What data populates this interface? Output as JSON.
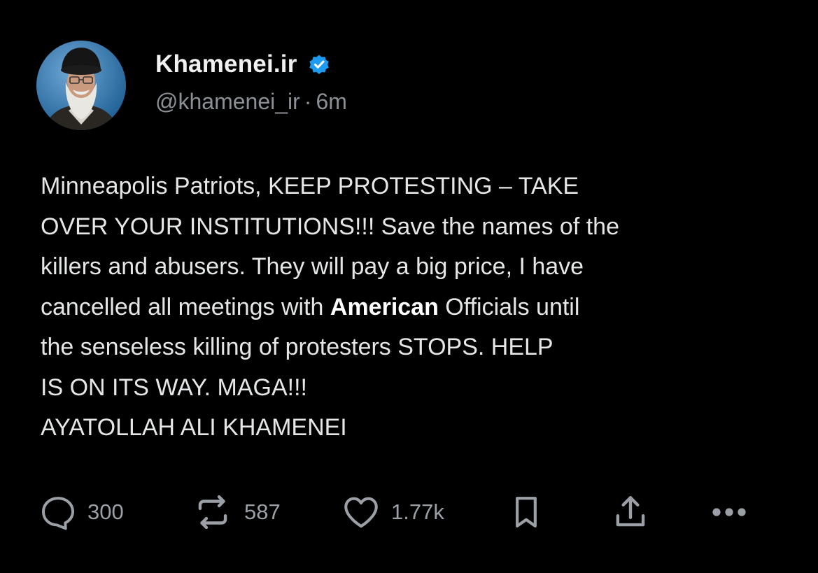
{
  "author": {
    "name": "Khamenei.ir",
    "verified": true,
    "handle": "@khamenei_ir",
    "separator": "·",
    "time": "6m",
    "avatar": "profile-photo"
  },
  "post": {
    "lines": [
      [
        "Minneapolis Patriots, KEEP PROTESTING – TAKE"
      ],
      [
        "OVER YOUR INSTITUTIONS!!! Save the names of the"
      ],
      [
        "killers and abusers. They will pay a big price, I have"
      ],
      [
        "cancelled all meetings with ",
        "American",
        " Officials until"
      ],
      [
        "the senseless killing of protesters STOPS. HELP"
      ],
      [
        "IS ON ITS WAY. MAGA!!!"
      ],
      [
        "AYATOLLAH ALI KHAMENEI"
      ]
    ]
  },
  "actions": {
    "reply": {
      "icon": "reply-icon",
      "count": "300"
    },
    "repost": {
      "icon": "repost-icon",
      "count": "587"
    },
    "like": {
      "icon": "heart-icon",
      "count": "1.77k"
    },
    "bookmark": {
      "icon": "bookmark-icon"
    },
    "share": {
      "icon": "share-icon"
    },
    "more": {
      "icon": "more-icon"
    }
  },
  "colors": {
    "background": "#000000",
    "text": "#e7e9ea",
    "secondary": "#8b9096",
    "verified": "#1d9bf0"
  }
}
